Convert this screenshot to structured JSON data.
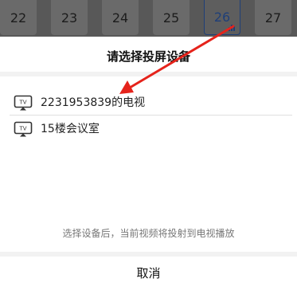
{
  "episodes": [
    "22",
    "23",
    "24",
    "25",
    "26",
    "27"
  ],
  "active_episode": "26",
  "sheet": {
    "title": "请选择投屏设备",
    "devices": [
      {
        "name": "2231953839的电视",
        "icon": "tv-icon"
      },
      {
        "name": "15楼会议室",
        "icon": "tv-icon"
      }
    ],
    "hint": "选择设备后，当前视频将投射到电视播放",
    "cancel_label": "取消"
  },
  "annotation": {
    "color": "#e5231b"
  }
}
